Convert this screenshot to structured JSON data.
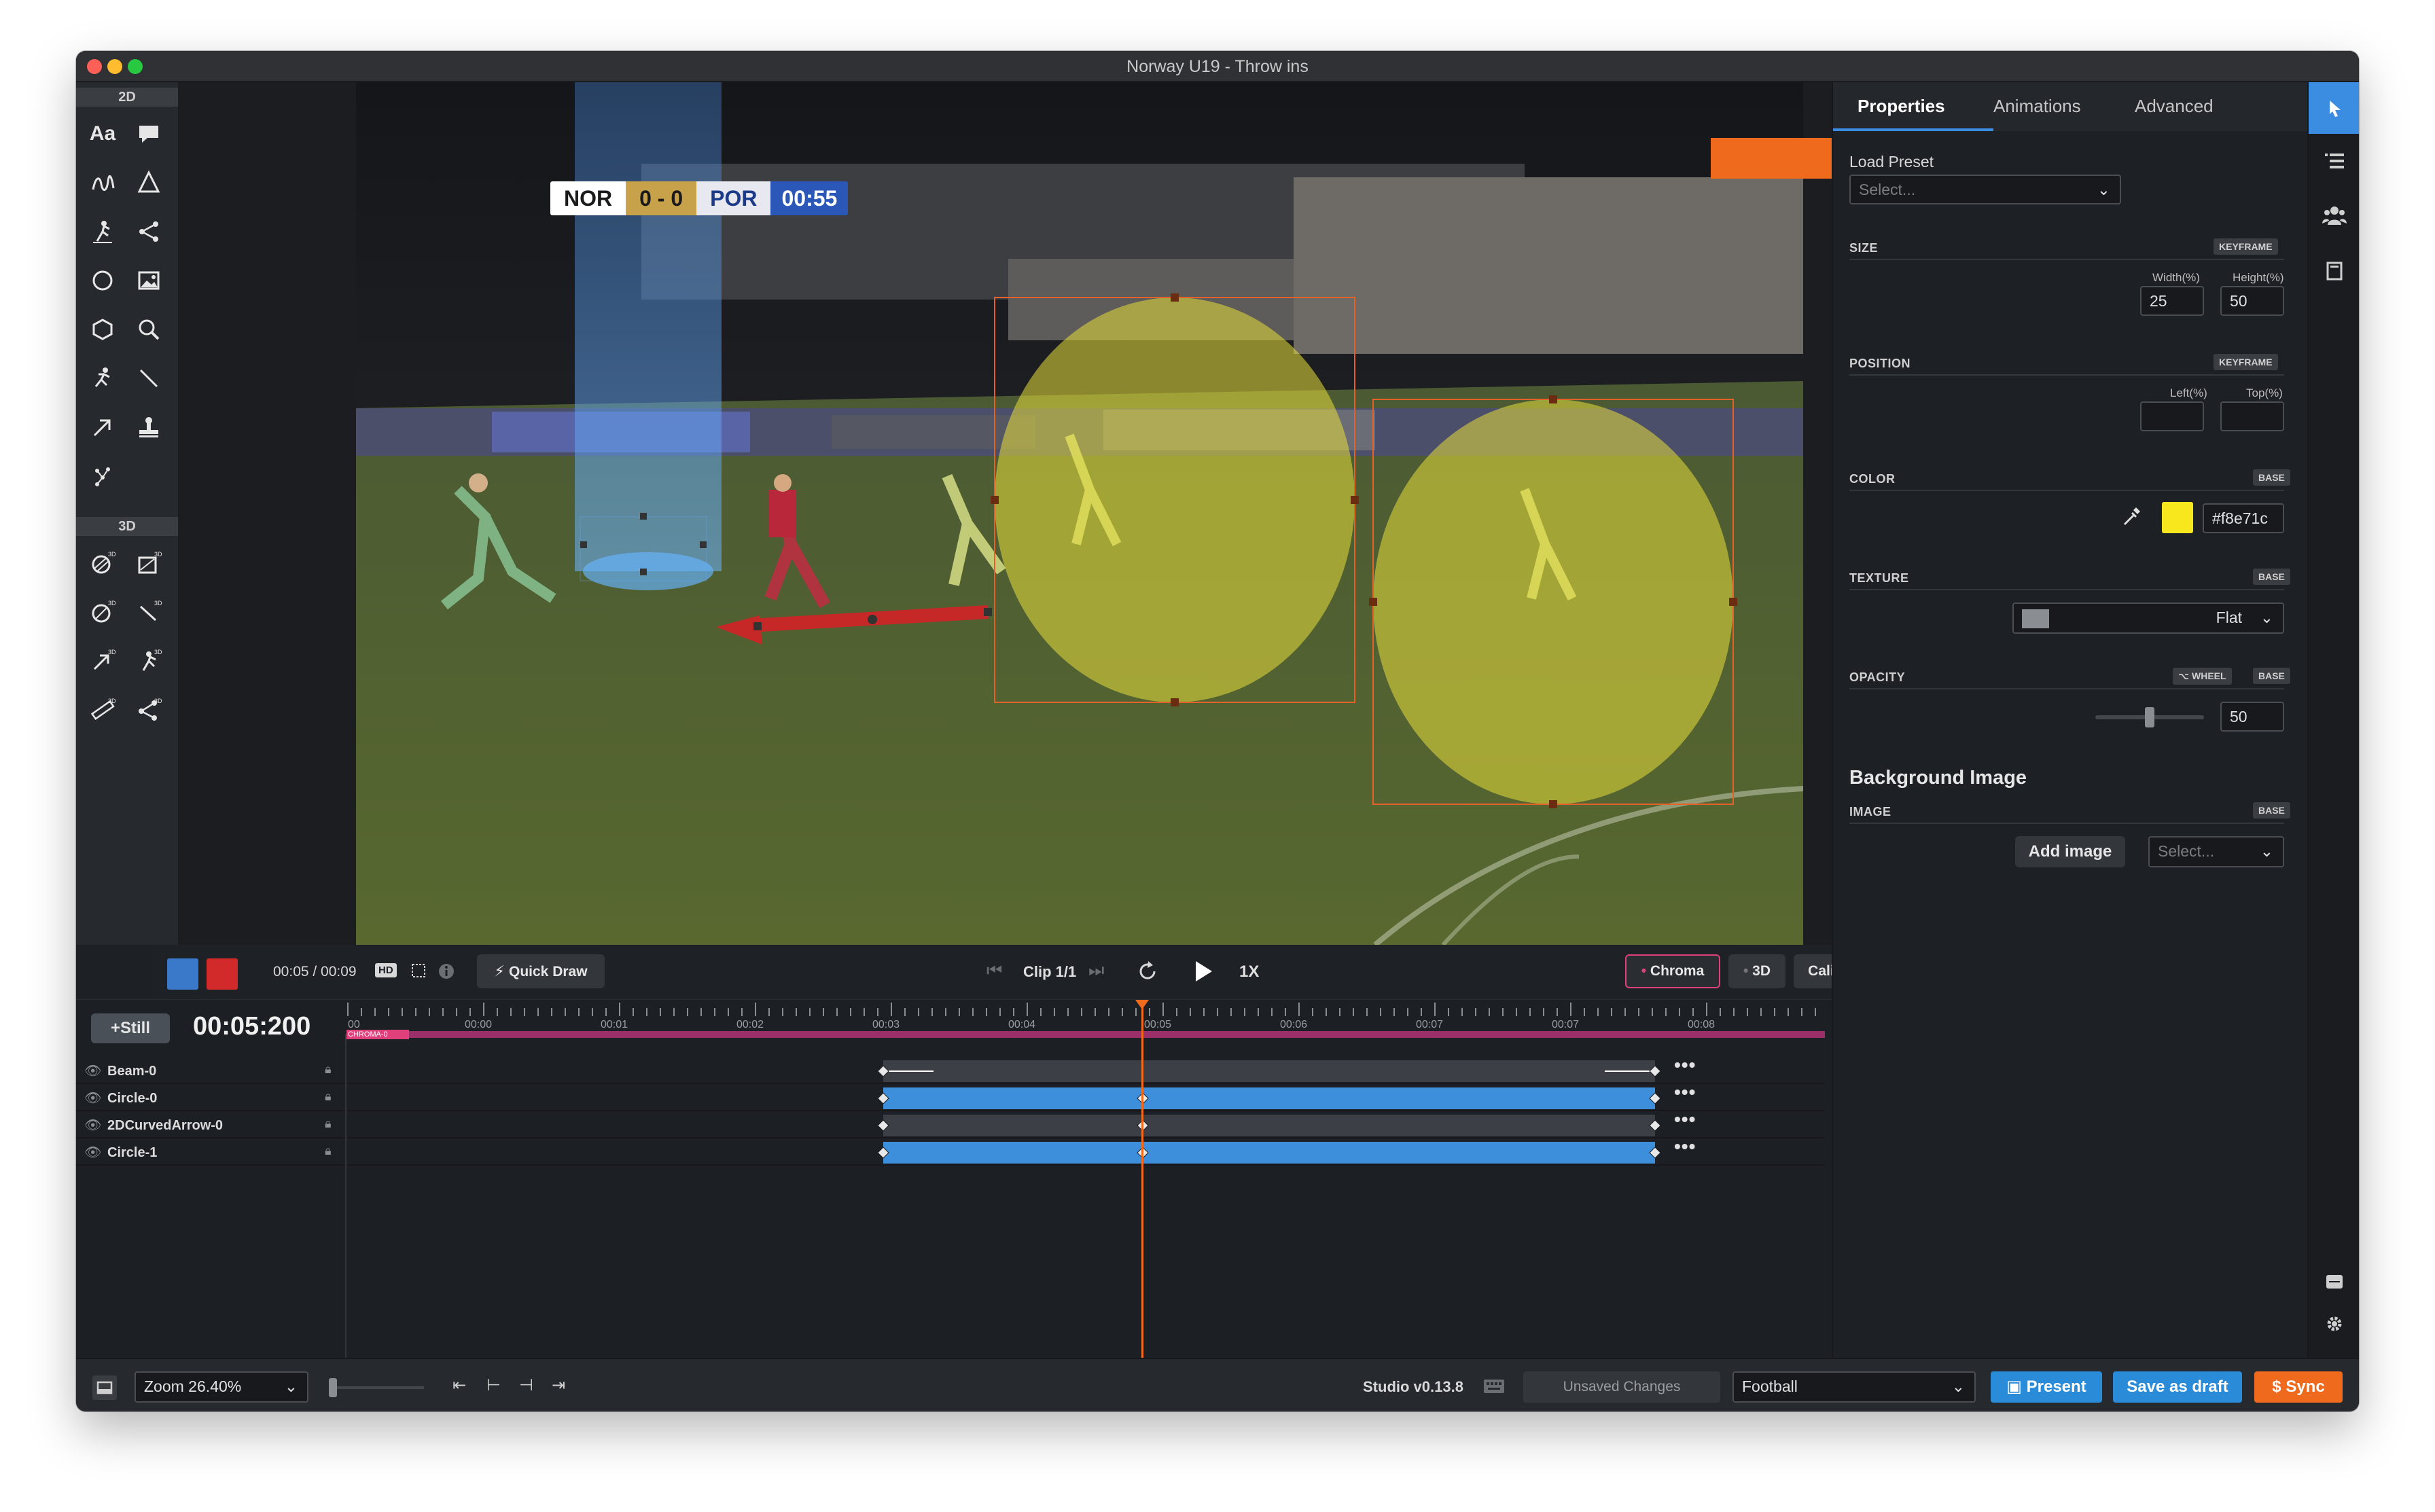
{
  "window": {
    "title": "Norway U19 - Throw ins"
  },
  "toolbar": {
    "section_2d": "2D",
    "section_3d": "3D",
    "text_tool": "Aa"
  },
  "scoreboard": {
    "home": "NOR",
    "score": "0 - 0",
    "away": "POR",
    "clock": "00:55",
    "colors": {
      "home_bg": "#ffffff",
      "score_bg": "#c8a24a",
      "away_bg": "#e8e8f0",
      "clock_bg": "#2a57b8"
    }
  },
  "transport": {
    "time": "00:05 / 00:09",
    "hd": "HD",
    "quick_draw": "Quick Draw",
    "clip": "Clip 1/1",
    "speed": "1X",
    "chroma": "Chroma",
    "three_d": "3D",
    "calibration": "Calibration",
    "swatch_primary": "#3a78c9",
    "swatch_secondary": "#d22a2a"
  },
  "timeline": {
    "still_button": "+Still",
    "current_time": "00:05:200",
    "ruler": [
      "00:00",
      "00:01",
      "00:02",
      "00:03",
      "00:04",
      "00:05",
      "00:06",
      "00:07",
      "00:07",
      "00:08"
    ],
    "ruler_start": "00",
    "chroma_label": "CHROMA-0",
    "layers": [
      {
        "name": "Beam-0"
      },
      {
        "name": "Circle-0"
      },
      {
        "name": "2DCurvedArrow-0"
      },
      {
        "name": "Circle-1"
      }
    ],
    "more": "•••"
  },
  "properties": {
    "tabs": [
      "Properties",
      "Animations",
      "Advanced"
    ],
    "load_preset_label": "Load Preset",
    "load_preset_placeholder": "Select...",
    "size": {
      "label": "SIZE",
      "badge": "KEYFRAME",
      "width_label": "Width(%)",
      "height_label": "Height(%)",
      "width": "25",
      "height": "50"
    },
    "position": {
      "label": "POSITION",
      "badge": "KEYFRAME",
      "left_label": "Left(%)",
      "top_label": "Top(%)",
      "left": "",
      "top": ""
    },
    "color": {
      "label": "COLOR",
      "badge": "BASE",
      "value": "#f8e71c"
    },
    "texture": {
      "label": "TEXTURE",
      "badge": "BASE",
      "value": "Flat"
    },
    "opacity": {
      "label": "OPACITY",
      "badge_wheel": "⌥ WHEEL",
      "badge": "BASE",
      "value": "50"
    },
    "background_image": {
      "heading": "Background Image",
      "label": "IMAGE",
      "badge": "BASE",
      "add_button": "Add image",
      "select_placeholder": "Select..."
    }
  },
  "statusbar": {
    "zoom": "Zoom 26.40%",
    "version": "Studio v0.13.8",
    "unsaved": "Unsaved Changes",
    "sport": "Football",
    "present": "Present",
    "save_draft": "Save as draft",
    "sync": "Sync",
    "colors": {
      "blue": "#2a8bd8",
      "orange": "#f06a1e"
    }
  }
}
